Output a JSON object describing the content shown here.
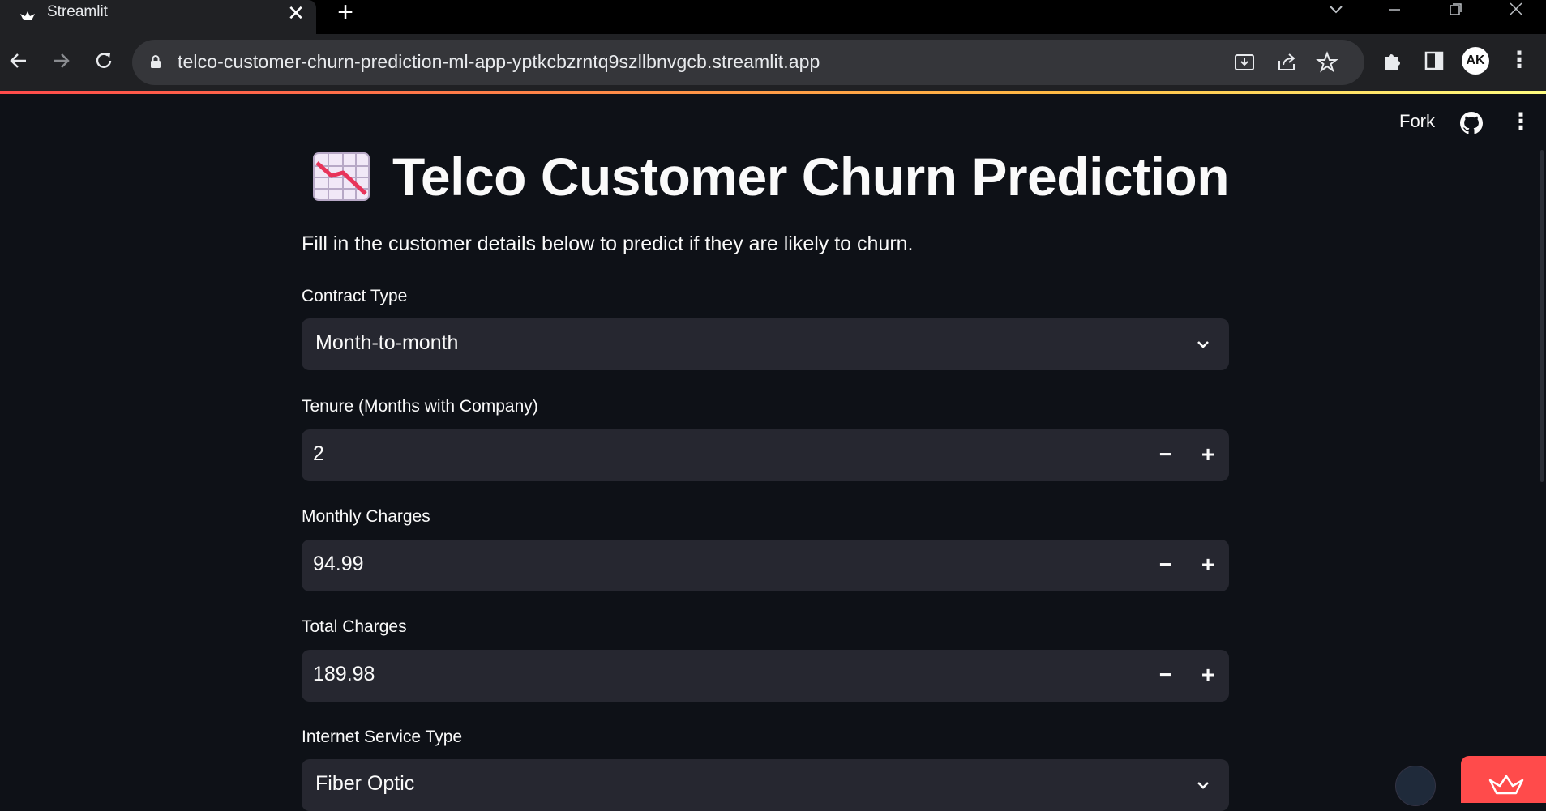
{
  "browser": {
    "tab_title": "Streamlit",
    "tab_close_glyph": "✕",
    "new_tab_glyph": "+",
    "url": "telco-customer-churn-prediction-ml-app-yptkcbzrntq9szllbnvgcb.streamlit.app",
    "profile_initials": "AK",
    "icons": {
      "favicon": "streamlit-crown-icon",
      "back": "back-arrow-icon",
      "forward": "forward-arrow-icon",
      "reload": "reload-icon",
      "lock": "lock-icon",
      "install": "install-app-icon",
      "share": "share-icon",
      "bookmark": "star-icon",
      "extensions": "puzzle-icon",
      "sidepanel": "side-panel-icon",
      "menu": "kebab-menu-icon"
    }
  },
  "app": {
    "header": {
      "fork_label": "Fork",
      "github_icon": "github-icon",
      "menu_icon": "kebab-menu-icon"
    },
    "title": "Telco Customer Churn Prediction",
    "title_emoji": "chart-decreasing-icon",
    "subtitle": "Fill in the customer details below to predict if they are likely to churn.",
    "fields": {
      "contract": {
        "label": "Contract Type",
        "value": "Month-to-month"
      },
      "tenure": {
        "label": "Tenure (Months with Company)",
        "value": "2"
      },
      "monthly": {
        "label": "Monthly Charges",
        "value": "94.99"
      },
      "total": {
        "label": "Total Charges",
        "value": "189.98"
      },
      "internet": {
        "label": "Internet Service Type",
        "value": "Fiber Optic"
      }
    },
    "stepper": {
      "minus": "−",
      "plus": "+"
    }
  },
  "colors": {
    "background": "#0e1117",
    "widget_bg": "#262730",
    "accent": "#ff4b4b",
    "text": "#fafafa"
  }
}
